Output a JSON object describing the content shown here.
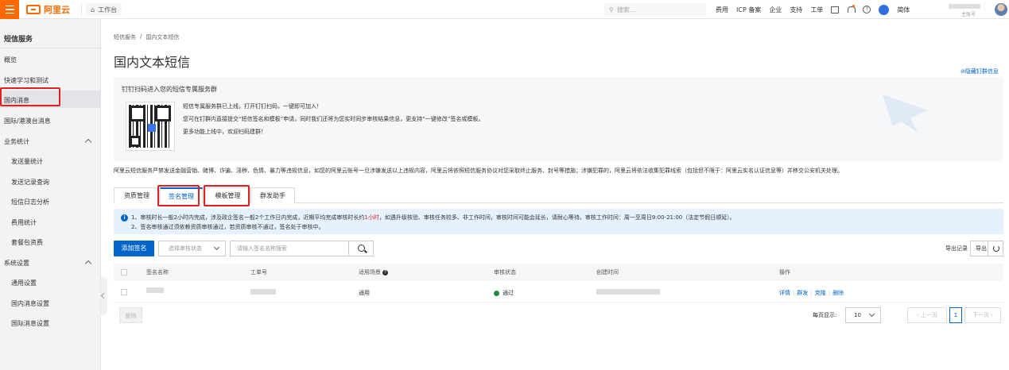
{
  "topbar": {
    "logo": "阿里云",
    "workbench": "工作台",
    "search_placeholder": "搜索...",
    "links": [
      "费用",
      "ICP 备案",
      "企业",
      "支持",
      "工单"
    ],
    "lang": "简体",
    "account_sub": "主账号"
  },
  "sidebar": {
    "title": "短信服务",
    "items": {
      "overview": "概览",
      "quickstart": "快速学习和测试",
      "domestic": "国内消息",
      "intl": "国际/港澳台消息",
      "stats_group": "业务统计",
      "send_stats": "发送量统计",
      "send_records": "发送记录查询",
      "log_analysis": "短信日志分析",
      "fee_stats": "费用统计",
      "package": "套餐包资费",
      "settings_group": "系统设置",
      "general": "通用设置",
      "domestic_settings": "国内消息设置",
      "intl_settings": "国际消息设置"
    }
  },
  "breadcrumb": {
    "root": "短信服务",
    "sep": "/",
    "current": "国内文本短信"
  },
  "page_title": "国内文本短信",
  "hide_dingtalk": "隐藏钉群信息",
  "promo": {
    "title": "钉钉扫码进入您的短信专属服务群",
    "line1": "短信专属服务群已上线，打开钉钉扫码，一键即可加入！",
    "line2": "您可在钉群内直接提交“短信签名和模板”申请，同时我们还将为您实时同步审核结果信息，更支持“一键修改”签名或模板。",
    "line3": "更多功能上线中，欢迎扫码建群！"
  },
  "notice": "阿里云短信服务严禁发送金融营销、赌博、诈骗、淫秽、色情、暴力等违规信息，如您的阿里云账号一旦涉嫌发送以上违规内容，阿里云将依照短信服务协议对您采取终止服务、封号等措施；涉嫌犯罪的，阿里云将依法收集犯罪线索（包括但不限于：阿里云实名认证信息等）并移交公安机关处理。",
  "tabs": [
    "资质管理",
    "签名管理",
    "模板管理",
    "群发助手"
  ],
  "info": {
    "line1_a": "1、审核时长一般2小时内完成，涉及政企签名一般2个工作日内完成，近期平均完成审核时长约",
    "line1_red": "1小时",
    "line1_b": "，如遇升级核验、审核任务较多、非工作时间，审核时间可能会延长，请耐心等待。审核工作时间：周一至周日9:00-21:00（法定节假日顺延）。",
    "line2": "2、签名审核通过须依赖资质审核通过，若资质审核不通过，签名处于审核中。"
  },
  "toolbar": {
    "add": "添加签名",
    "status_placeholder": "选择审核状态",
    "search_placeholder": "请输入签名名称搜索",
    "export_log": "导出记录",
    "export": "导出"
  },
  "table": {
    "headers": [
      "签名名称",
      "工单号",
      "适用场景",
      "审核状态",
      "创建时间",
      "操作"
    ],
    "rows": [
      {
        "scene": "通用",
        "status": "通过",
        "ops": [
          "详情",
          "群发",
          "克隆",
          "删除"
        ]
      }
    ]
  },
  "footer": {
    "delete": "删除",
    "per_page_label": "每页显示:",
    "per_page": "10",
    "prev": "上一页",
    "page": "1",
    "next": "下一页"
  },
  "colors": {
    "brand": "#ff6a00",
    "primary": "#0064c8",
    "highlight": "#e02020"
  }
}
